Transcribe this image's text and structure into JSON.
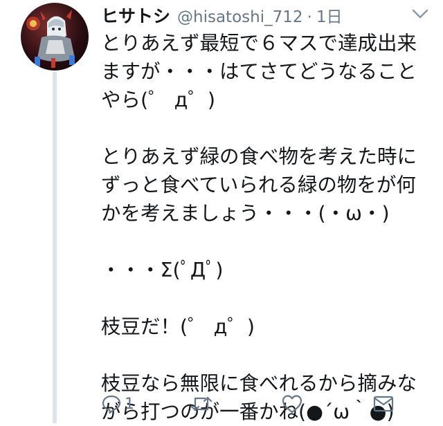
{
  "tweet": {
    "display_name": "ヒサトシ",
    "handle": "@hisatoshi_712",
    "separator": "·",
    "time": "1日",
    "lines": [
      "とりあえず最短で６マスで達成出来",
      "ますが・・・はてさてどうなること",
      "やら(゜ д゜)",
      "",
      "とりあえず緑の食べ物を考えた時に",
      "ずっと食べていられる緑の物をが何",
      "かを考えましょう・・・(・ω・)",
      "",
      "・・・Σ(ﾟДﾟ)",
      "",
      "枝豆だ！(゜ д゜)",
      "",
      "枝豆なら無限に食べれるから摘みな",
      "がら打つのが一番かね(●´ω｀●)"
    ]
  },
  "actions": {
    "reply": {
      "icon": "reply-icon",
      "count": "1"
    },
    "retweet": {
      "icon": "retweet-icon",
      "count": ""
    },
    "like": {
      "icon": "heart-icon",
      "count": ""
    },
    "message": {
      "icon": "envelope-icon"
    }
  },
  "colors": {
    "text": "#14171a",
    "secondary": "#657786",
    "thread_line": "#dfe4e8"
  }
}
